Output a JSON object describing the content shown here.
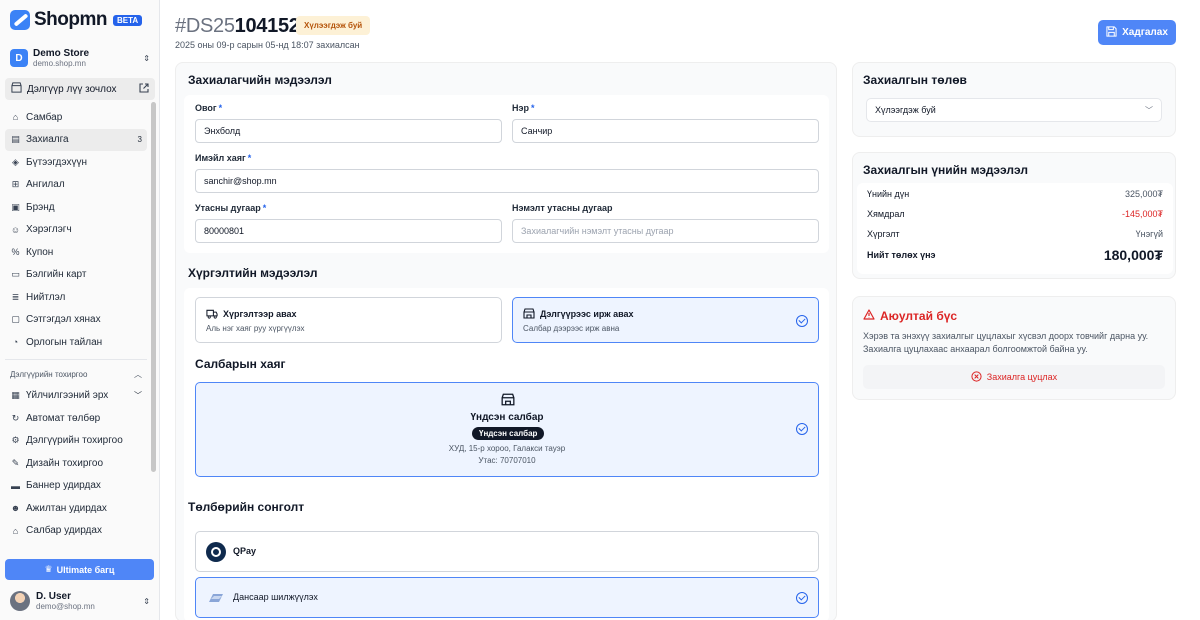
{
  "brand": {
    "name": "Shopmn",
    "badge": "BETA"
  },
  "store": {
    "initial": "D",
    "name": "Demo Store",
    "domain": "demo.shop.mn"
  },
  "visit_store": "Дэлгүүр лүү зочлох",
  "nav": [
    {
      "label": "Самбар",
      "icon": "dashboard-icon"
    },
    {
      "label": "Захиалга",
      "icon": "orders-icon",
      "count": "3",
      "active": true
    },
    {
      "label": "Бүтээгдэхүүн",
      "icon": "product-icon"
    },
    {
      "label": "Ангилал",
      "icon": "category-icon"
    },
    {
      "label": "Брэнд",
      "icon": "brand-icon"
    },
    {
      "label": "Хэрэглэгч",
      "icon": "user-icon"
    },
    {
      "label": "Купон",
      "icon": "coupon-icon"
    },
    {
      "label": "Бэлгийн карт",
      "icon": "gift-card-icon"
    },
    {
      "label": "Нийтлэл",
      "icon": "article-icon"
    },
    {
      "label": "Сэтгэгдэл хянах",
      "icon": "review-icon"
    },
    {
      "label": "Орлогын тайлан",
      "icon": "report-icon"
    }
  ],
  "settings_section": {
    "title": "Дэлгүүрийн тохиргоо",
    "items": [
      {
        "label": "Үйлчилгээний эрх",
        "icon": "license-icon",
        "chevron": true
      },
      {
        "label": "Автомат төлбөр",
        "icon": "autopay-icon"
      },
      {
        "label": "Дэлгүүрийн тохиргоо",
        "icon": "settings-icon"
      },
      {
        "label": "Дизайн тохиргоо",
        "icon": "design-icon"
      },
      {
        "label": "Баннер удирдах",
        "icon": "banner-icon"
      },
      {
        "label": "Ажилтан удирдах",
        "icon": "staff-icon"
      },
      {
        "label": "Салбар удирдах",
        "icon": "branch-icon"
      }
    ]
  },
  "ultimate_button": "Ultimate багц",
  "user": {
    "name": "D. User",
    "email": "demo@shop.mn"
  },
  "header": {
    "order_prefix": "#DS25",
    "order_number": "104152",
    "status": "Хүлээгдэж буй",
    "date": "2025 оны 09-р сарын 05-нд 18:07 захиалсан",
    "save_label": "Хадгалах"
  },
  "customer": {
    "title": "Захиалагчийн мэдээлэл",
    "last_name_label": "Овог",
    "last_name": "Энхболд",
    "first_name_label": "Нэр",
    "first_name": "Санчир",
    "email_label": "Имэйл хаяг",
    "email": "sanchir@shop.mn",
    "phone_label": "Утасны дугаар",
    "phone": "80000801",
    "extra_phone_label": "Нэмэлт утасны дугаар",
    "extra_phone_placeholder": "Захиалагчийн нэмэлт утасны дугаар"
  },
  "delivery": {
    "title": "Хүргэлтийн мэдээлэл",
    "options": [
      {
        "title": "Хүргэлтээр авах",
        "subtitle": "Аль нэг хаяг руу хүргүүлэх",
        "selected": false
      },
      {
        "title": "Дэлгүүрээс ирж авах",
        "subtitle": "Салбар дээрээс ирж авна",
        "selected": true
      }
    ],
    "branch_title": "Салбарын хаяг",
    "branch": {
      "name": "Үндсэн салбар",
      "tag": "Үндсэн салбар",
      "address": "ХУД, 15-р хороо, Галакси тауэр",
      "phone": "Утас: 70707010"
    }
  },
  "payment": {
    "title": "Төлбөрийн сонголт",
    "options": [
      {
        "name": "QPay",
        "icon": "qpay-icon",
        "selected": false
      },
      {
        "name": "Дансаар шилжүүлэх",
        "icon": "bank-transfer-icon",
        "selected": true
      }
    ]
  },
  "order_status": {
    "title": "Захиалгын төлөв",
    "selected": "Хүлээгдэж буй"
  },
  "price_info": {
    "title": "Захиалгын үнийн мэдээлэл",
    "rows": [
      {
        "label": "Үнийн дүн",
        "value": "325,000₮"
      },
      {
        "label": "Хямдрал",
        "value": "-145,000₮"
      },
      {
        "label": "Хүргэлт",
        "value": "Үнэгүй"
      }
    ],
    "total_label": "Нийт төлөх үнэ",
    "total_value": "180,000₮"
  },
  "danger": {
    "title": "Аюултай бүс",
    "text": "Хэрэв та энэхүү захиалгыг цуцлахыг хүсвэл доорх товчийг дарна уу. Захиалга цуцлахаас анхаарал болгоомжтой байна уу.",
    "cancel_label": "Захиалга цуцлах"
  },
  "colors": {
    "accent": "#4f86f7",
    "danger": "#dc2626",
    "status_bg": "#fdf1d6",
    "status_text": "#b45309"
  }
}
